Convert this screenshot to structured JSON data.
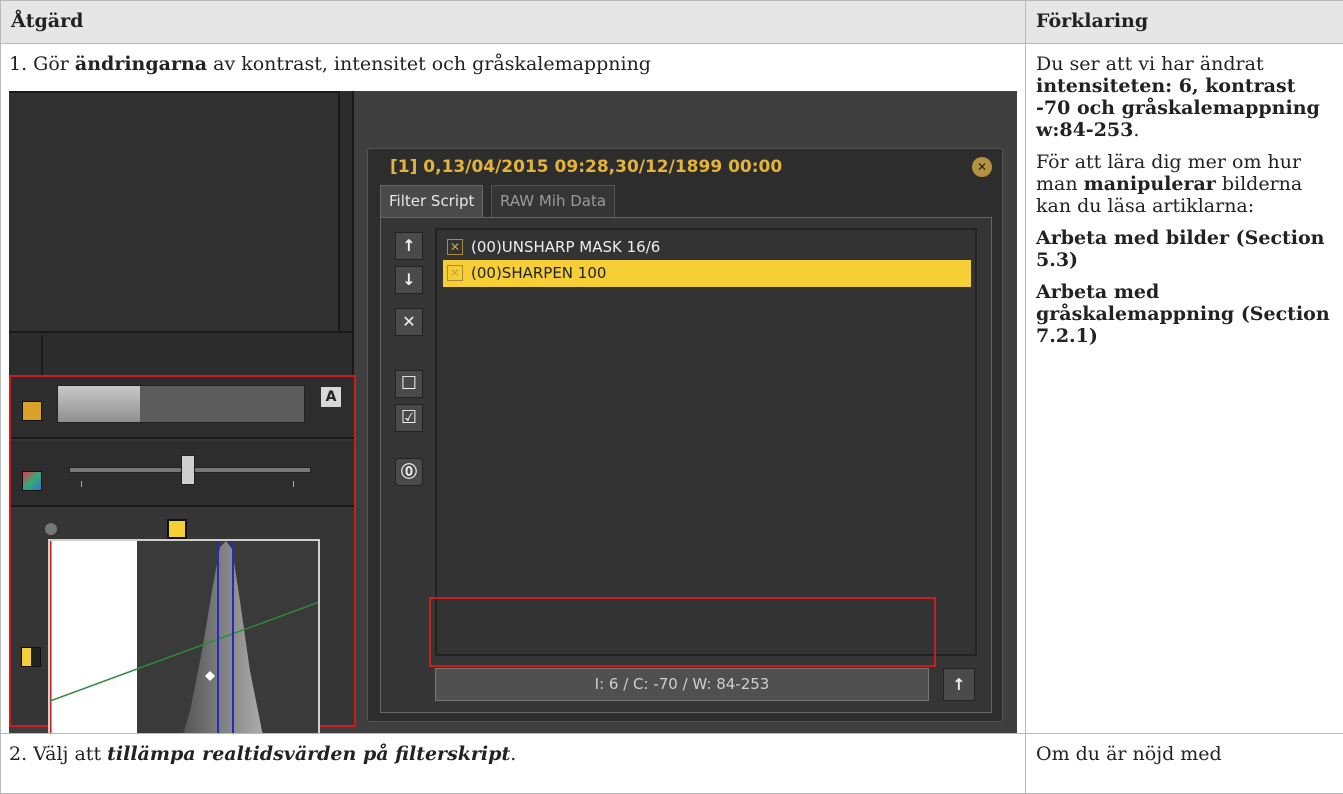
{
  "table": {
    "header": {
      "action": "Åtgärd",
      "explanation": "Förklaring"
    },
    "row1": {
      "step_num": "1. Gör ",
      "step_bold": "ändringarna",
      "step_rest": " av kontrast, intensitet och gråskalemappning",
      "desc_p1_a": "Du ser att vi har ändrat ",
      "desc_p1_b": "intensiteten: 6, kontrast -70 och gråskalemappning w:84-253",
      "desc_p1_c": ".",
      "desc_p2_a": "För att lära dig mer om hur man ",
      "desc_p2_b": "manipulerar",
      "desc_p2_c": " bilderna kan du läsa artiklarna:",
      "link1": "Arbeta med bilder (Section 5.3)",
      "link2": "Arbeta med gråskalemappning (Section 7.2.1)"
    },
    "row2": {
      "step_num": "2. Välj att ",
      "step_bi": "tillämpa realtidsvärden på filterskript",
      "step_rest": ".",
      "desc": "Om du är nöjd med"
    }
  },
  "screenshot": {
    "panel_title": "[1] 0,13/04/2015 09:28,30/12/1899 00:00",
    "tabs": [
      "Filter Script",
      "RAW Mih Data"
    ],
    "filters": [
      {
        "label": "(00)UNSHARP MASK 16/6",
        "selected": false
      },
      {
        "label": "(00)SHARPEN 100",
        "selected": true
      }
    ],
    "value_field": "I: 6 / C: -70 / W: 84-253",
    "auto_label": "A",
    "colors": {
      "accent": "#f6cf37",
      "highlight": "#c81e1e",
      "panel": "#2d2d2d"
    }
  }
}
